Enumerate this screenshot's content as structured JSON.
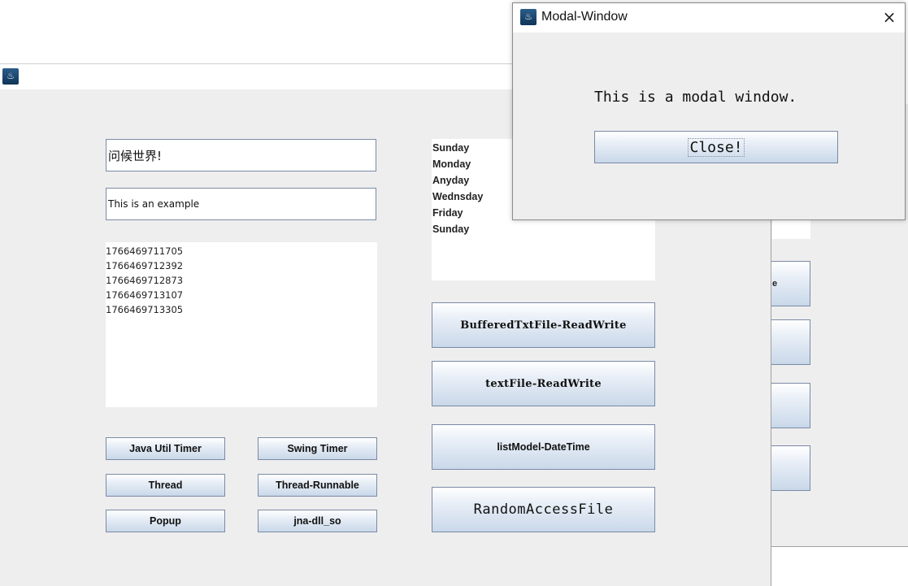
{
  "main_window": {
    "text_field_1": "问候世界!",
    "text_field_2": "This is an example",
    "text_area_lines": [
      "1766469711705",
      "1766469712392",
      "1766469712873",
      "1766469713107",
      "1766469713305"
    ],
    "day_list": [
      "Sunday",
      "Monday",
      "Anyday",
      "Wednsday",
      "Friday",
      "Sunday"
    ],
    "buttons": {
      "java_util_timer": "Java Util Timer",
      "swing_timer": "Swing Timer",
      "thread": "Thread",
      "thread_runnable": "Thread-Runnable",
      "popup": "Popup",
      "jna_dll_so": "jna-dll_so",
      "buffered_txt_file": "BufferedTxtFile-ReadWrite",
      "text_file": "textFile-ReadWrite",
      "list_model": "listModel-DateTime",
      "random_access_file": "RandomAccessFile"
    }
  },
  "background_window": {
    "partial_button_text": "e"
  },
  "modal": {
    "title": "Modal-Window",
    "message": "This is a modal window.",
    "close_button": "Close!",
    "close_icon": "×"
  },
  "icons": {
    "app": "java-icon"
  }
}
